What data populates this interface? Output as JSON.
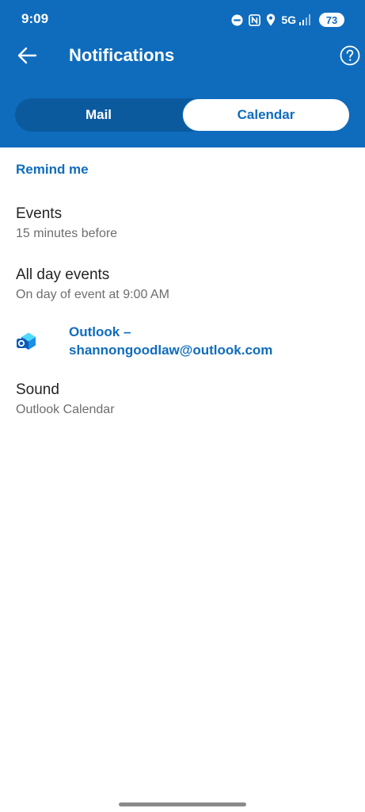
{
  "status_bar": {
    "time": "9:09",
    "network": "5G",
    "battery": "73",
    "icons": [
      "do-not-disturb-icon",
      "nfc-icon",
      "location-icon",
      "signal-icon"
    ]
  },
  "header": {
    "title": "Notifications",
    "back_icon": "arrow-left-icon",
    "help_icon": "question-circle-icon",
    "background_color": "#0f6cbd"
  },
  "tabs": {
    "items": [
      {
        "label": "Mail",
        "selected": false
      },
      {
        "label": "Calendar",
        "selected": true
      }
    ]
  },
  "section": {
    "title": "Remind me"
  },
  "settings": {
    "events": {
      "title": "Events",
      "value": "15 minutes before"
    },
    "all_day_events": {
      "title": "All day events",
      "value": "On day of event at 9:00 AM"
    },
    "account": {
      "line1": "Outlook –",
      "line2": "shannongoodlaw@outlook.com",
      "icon": "outlook-icon"
    },
    "sound": {
      "title": "Sound",
      "value": "Outlook Calendar"
    }
  },
  "colors": {
    "accent": "#0f6cbd",
    "primary_text": "#242424",
    "secondary_text": "#6e6e6e"
  }
}
